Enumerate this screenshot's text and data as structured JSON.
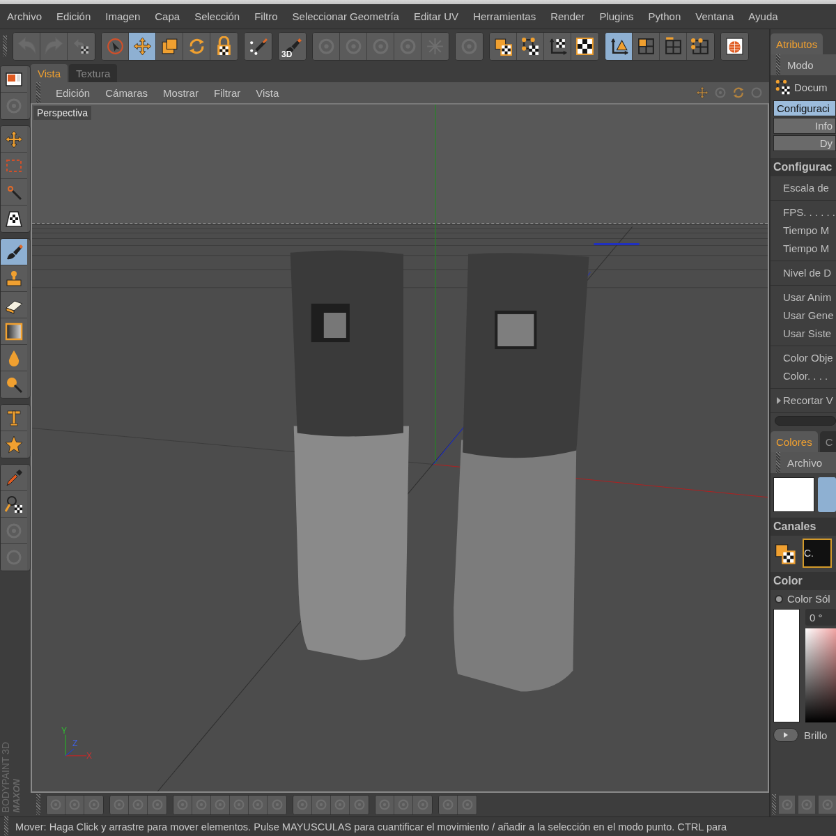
{
  "menu": [
    "Archivo",
    "Edición",
    "Imagen",
    "Capa",
    "Selección",
    "Filtro",
    "Seleccionar Geometría",
    "Editar UV",
    "Herramientas",
    "Render",
    "Plugins",
    "Python",
    "Ventana",
    "Ayuda"
  ],
  "toolbar": [
    [
      {
        "kind": "undo",
        "selected": false,
        "disabled": true
      },
      {
        "kind": "redo",
        "selected": false,
        "disabled": true
      },
      {
        "kind": "undo-texture",
        "selected": false,
        "disabled": true
      }
    ],
    [
      {
        "kind": "select",
        "selected": false,
        "disabled": false
      },
      {
        "kind": "move",
        "selected": true,
        "disabled": false
      },
      {
        "kind": "scale",
        "selected": false,
        "disabled": false
      },
      {
        "kind": "rotate",
        "selected": false,
        "disabled": false
      },
      {
        "kind": "lock",
        "selected": false,
        "disabled": false
      }
    ],
    [
      {
        "kind": "sparkle-brush",
        "selected": false,
        "disabled": false
      }
    ],
    [
      {
        "kind": "brush",
        "label": "3D",
        "selected": false,
        "disabled": false
      }
    ],
    [
      {
        "kind": "gear",
        "selected": false,
        "disabled": true
      },
      {
        "kind": "gear",
        "selected": false,
        "disabled": true
      },
      {
        "kind": "gear",
        "selected": false,
        "disabled": true
      },
      {
        "kind": "gear",
        "selected": false,
        "disabled": true
      },
      {
        "kind": "snowflake",
        "selected": false,
        "disabled": true
      }
    ],
    [
      {
        "kind": "gear",
        "selected": false,
        "disabled": true
      }
    ],
    [
      {
        "kind": "texture-layers",
        "selected": false,
        "disabled": false
      },
      {
        "kind": "texture-points",
        "selected": false,
        "disabled": false
      },
      {
        "kind": "texture-axis",
        "selected": false,
        "disabled": false
      },
      {
        "kind": "checker",
        "selected": false,
        "disabled": false
      }
    ],
    [
      {
        "kind": "axis-triangle",
        "selected": true,
        "disabled": false
      },
      {
        "kind": "grid-square",
        "selected": false,
        "disabled": false
      },
      {
        "kind": "grid-edge",
        "selected": false,
        "disabled": false
      },
      {
        "kind": "grid-points",
        "selected": false,
        "disabled": false
      }
    ],
    [
      {
        "kind": "globe",
        "selected": false,
        "disabled": false
      }
    ]
  ],
  "side_tools": [
    [
      {
        "kind": "layout",
        "selected": false,
        "disabled": false
      },
      {
        "kind": "gear",
        "selected": false,
        "disabled": true
      }
    ],
    [
      {
        "kind": "move-small",
        "selected": false,
        "disabled": false
      },
      {
        "kind": "rect-select",
        "selected": false,
        "disabled": false
      },
      {
        "kind": "wand",
        "selected": false,
        "disabled": false
      },
      {
        "kind": "projection",
        "selected": false,
        "disabled": false
      }
    ],
    [
      {
        "kind": "brush",
        "selected": true,
        "disabled": false
      },
      {
        "kind": "stamp",
        "selected": false,
        "disabled": false
      },
      {
        "kind": "eraser",
        "selected": false,
        "disabled": false
      },
      {
        "kind": "gradient",
        "selected": false,
        "disabled": false
      },
      {
        "kind": "drop",
        "selected": false,
        "disabled": false
      },
      {
        "kind": "magnify",
        "selected": false,
        "disabled": false
      }
    ],
    [
      {
        "kind": "type",
        "selected": false,
        "disabled": false
      },
      {
        "kind": "star",
        "selected": false,
        "disabled": false
      }
    ],
    [
      {
        "kind": "dropper",
        "selected": false,
        "disabled": false
      },
      {
        "kind": "clone",
        "selected": false,
        "disabled": false
      },
      {
        "kind": "gear",
        "selected": false,
        "disabled": true
      },
      {
        "kind": "circle",
        "selected": false,
        "disabled": true
      }
    ]
  ],
  "brand": [
    "MAXON",
    "BODYPAINT 3D"
  ],
  "viewport": {
    "tabs": [
      {
        "label": "Vista",
        "selected": true
      },
      {
        "label": "Textura",
        "selected": false
      }
    ],
    "menu": [
      "Edición",
      "Cámaras",
      "Mostrar",
      "Filtrar",
      "Vista"
    ],
    "camera": "Perspectiva",
    "axes": {
      "y": "Y",
      "z": "Z",
      "x": "X"
    }
  },
  "bottom_toolbar": [
    [
      {
        "kind": "gear",
        "disabled": true
      },
      {
        "kind": "gear",
        "disabled": true
      },
      {
        "kind": "gear",
        "disabled": true
      }
    ],
    [
      {
        "kind": "gear",
        "disabled": true
      },
      {
        "kind": "gear",
        "disabled": true
      },
      {
        "kind": "gear",
        "disabled": true
      }
    ],
    [
      {
        "kind": "gear",
        "disabled": true
      },
      {
        "kind": "gear",
        "disabled": true
      },
      {
        "kind": "gear",
        "disabled": true
      },
      {
        "kind": "gear",
        "disabled": true
      },
      {
        "kind": "gear",
        "disabled": true
      },
      {
        "kind": "gear",
        "disabled": true
      }
    ],
    [
      {
        "kind": "gear",
        "disabled": true
      },
      {
        "kind": "gear",
        "disabled": true
      },
      {
        "kind": "gear",
        "disabled": true
      },
      {
        "kind": "gear",
        "disabled": true
      }
    ],
    [
      {
        "kind": "gear",
        "disabled": true
      },
      {
        "kind": "gear",
        "disabled": true
      },
      {
        "kind": "gear",
        "disabled": true
      }
    ],
    [
      {
        "kind": "gear",
        "disabled": true
      },
      {
        "kind": "gear",
        "disabled": true
      }
    ]
  ],
  "attributes": {
    "tab": {
      "label": "Atributos",
      "selected": true
    },
    "menu": "Modo",
    "object": "Docum",
    "buttons": [
      {
        "label": "Configuraci",
        "selected": true
      },
      {
        "label": "Info",
        "selected": false
      },
      {
        "label": "Dy",
        "selected": false
      }
    ],
    "section": "Configurac",
    "field_groups": [
      [
        "Escala de"
      ],
      [
        "FPS. . . . . .",
        "Tiempo M",
        "Tiempo M"
      ],
      [
        "Nivel de D"
      ],
      [
        "Usar Anim",
        "Usar Gene",
        "Usar Siste"
      ],
      [
        "Color Obje",
        "Color. . . ."
      ]
    ],
    "collapsed": {
      "label": "Recortar V",
      "expanded": false
    }
  },
  "colors": {
    "tabs": [
      {
        "label": "Colores",
        "selected": true
      },
      {
        "label": "C",
        "selected": false
      }
    ],
    "menu": "Archivo",
    "channels": "Canales",
    "channel": {
      "label": "C.",
      "selected": true
    },
    "color_section": "Color",
    "mode": {
      "label": "Color Sól",
      "selected": true
    },
    "hue": "0 °",
    "brightness": {
      "label": "Brillo",
      "expanded": false
    }
  },
  "right_bottom_tools": [
    {
      "kind": "gear",
      "disabled": true
    },
    {
      "kind": "gear",
      "disabled": true
    },
    {
      "kind": "gear",
      "disabled": true
    }
  ],
  "status": "Mover: Haga Click y arrastre para mover elementos. Pulse MAYUSCULAS para cuantificar el movimiento / añadir a la selección en el modo punto. CTRL para"
}
